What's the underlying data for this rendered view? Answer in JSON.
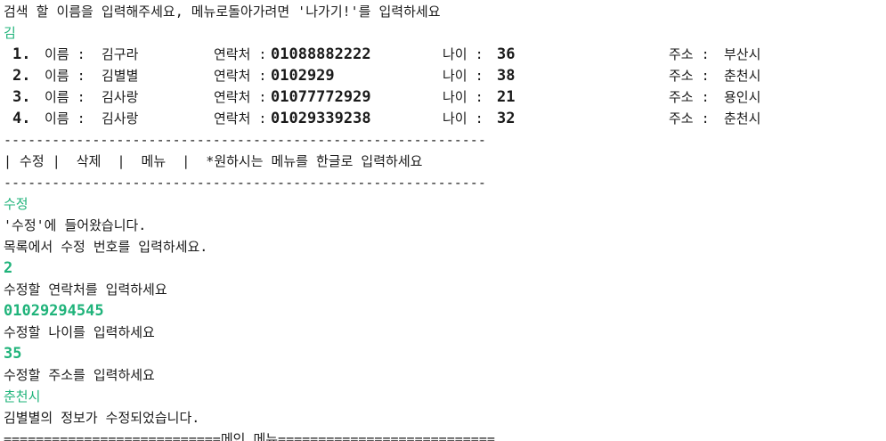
{
  "colors": {
    "input_text": "#1fb37a",
    "output_text": "#1a1a1a",
    "background": "#ffffff"
  },
  "prompt_search": "검색 할 이름을 입력해주세요, 메뉴로돌아가려면 '나가기!'를 입력하세요",
  "user_input_search": "김",
  "results": [
    {
      "num": "1.",
      "name_label": "이름 :",
      "name": "김구라",
      "contact_label": "연락처 :",
      "contact": "01088882222",
      "age_label": "나이 :",
      "age": "36",
      "addr_label": "주소 :",
      "addr": "부산시"
    },
    {
      "num": "2.",
      "name_label": "이름 :",
      "name": "김별별",
      "contact_label": "연락처 :",
      "contact": "0102929",
      "age_label": "나이 :",
      "age": "38",
      "addr_label": "주소 :",
      "addr": "춘천시"
    },
    {
      "num": "3.",
      "name_label": "이름 :",
      "name": "김사랑",
      "contact_label": "연락처 :",
      "contact": "01077772929",
      "age_label": "나이 :",
      "age": "21",
      "addr_label": "주소 :",
      "addr": "용인시"
    },
    {
      "num": "4.",
      "name_label": "이름 :",
      "name": "김사랑",
      "contact_label": "연락처 :",
      "contact": "01029339238",
      "age_label": "나이 :",
      "age": "32",
      "addr_label": "주소 :",
      "addr": "춘천시"
    }
  ],
  "separator_dash": "------------------------------------------------------------",
  "menu_bar": "| 수정 |  삭제  |  메뉴  |  *원하시는 메뉴를 한글로 입력하세요",
  "user_input_menu": "수정",
  "msg_entered": "'수정'에 들어왔습니다.",
  "prompt_number": "목록에서 수정 번호를 입력하세요.",
  "user_input_number": "2",
  "prompt_contact": "수정할 연락처를 입력하세요",
  "user_input_contact": "01029294545",
  "prompt_age": "수정할 나이를 입력하세요",
  "user_input_age": "35",
  "prompt_addr": "수정할 주소를 입력하세요",
  "user_input_addr": "춘천시",
  "msg_done": "김별별의 정보가 수정되었습니다.",
  "footer_main_menu": "===========================메인 메뉴==========================="
}
